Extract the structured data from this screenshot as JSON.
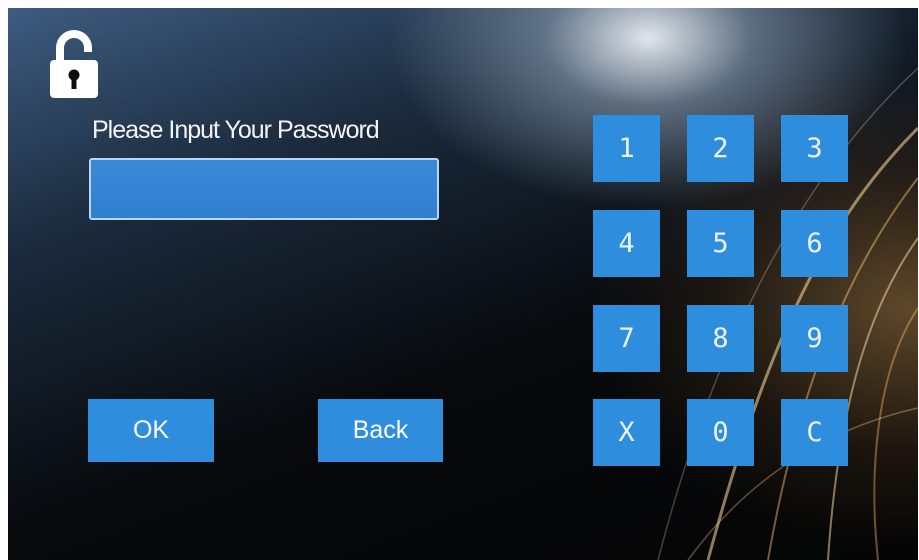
{
  "prompt": {
    "label": "Please Input Your Password"
  },
  "password_field": {
    "value": "",
    "placeholder": ""
  },
  "buttons": {
    "ok_label": "OK",
    "back_label": "Back"
  },
  "keypad": {
    "keys": [
      "1",
      "2",
      "3",
      "4",
      "5",
      "6",
      "7",
      "8",
      "9",
      "X",
      "0",
      "C"
    ]
  },
  "colors": {
    "accent": "#2e8ddd",
    "input_fill": "#3383d2",
    "input_border": "#b8d6f2",
    "text": "#f3f3f3",
    "background_dark": "#050505"
  },
  "icons": {
    "lock": "unlocked-padlock-icon"
  }
}
